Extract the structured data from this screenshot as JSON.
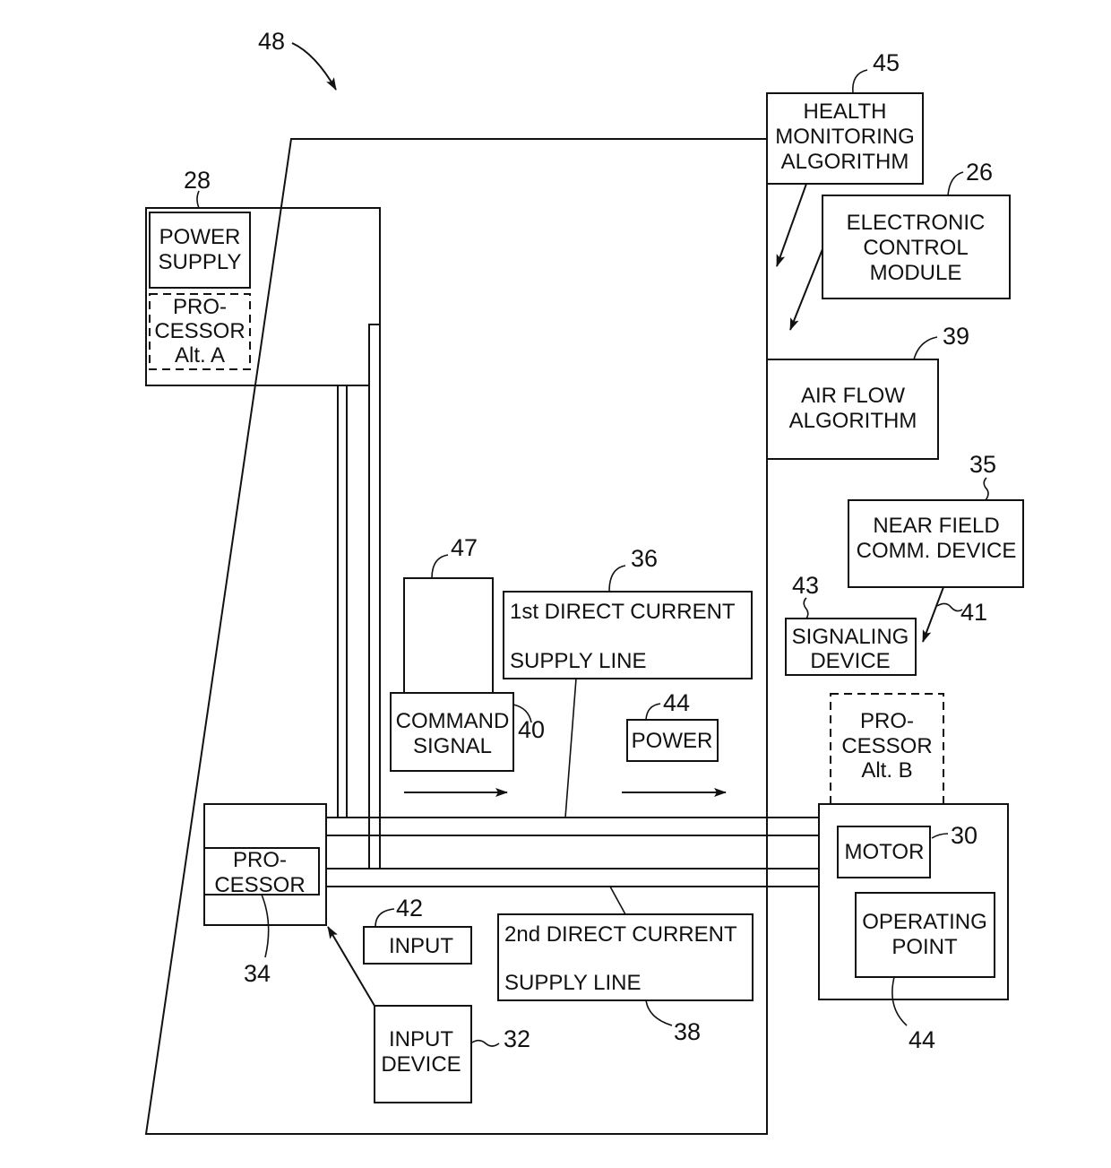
{
  "figure": {
    "assembly_ref": "48",
    "blocks": {
      "power_supply_housing": {
        "ref": "28"
      },
      "power_supply": {
        "lines": [
          "POWER",
          "SUPPLY"
        ]
      },
      "processor_alt_a": {
        "lines": [
          "PRO-",
          "CESSOR",
          "Alt. A"
        ]
      },
      "health_monitoring": {
        "ref": "45",
        "lines": [
          "HEALTH",
          "MONITORING",
          "ALGORITHM"
        ]
      },
      "electronic_control_module": {
        "ref": "26",
        "lines": [
          "ELECTRONIC",
          "CONTROL",
          "MODULE"
        ]
      },
      "air_flow_algorithm": {
        "ref": "39",
        "lines": [
          "AIR FLOW",
          "ALGORITHM"
        ]
      },
      "near_field_comm": {
        "ref": "35",
        "lines": [
          "NEAR FIELD",
          "COMM. DEVICE"
        ]
      },
      "signaling_device": {
        "ref": "43",
        "lines": [
          "SIGNALING",
          "DEVICE"
        ]
      },
      "nfc_link": {
        "ref": "41"
      },
      "block_47": {
        "ref": "47"
      },
      "command_signal": {
        "ref": "40",
        "lines": [
          "COMMAND",
          "SIGNAL"
        ]
      },
      "first_dc_line": {
        "ref": "36",
        "lines": [
          "1st DIRECT CURRENT",
          "SUPPLY LINE"
        ]
      },
      "power": {
        "ref": "44",
        "lines": [
          "POWER"
        ]
      },
      "processor_alt_b": {
        "lines": [
          "PRO-",
          "CESSOR",
          "Alt. B"
        ]
      },
      "motor": {
        "ref": "30",
        "lines": [
          "MOTOR"
        ]
      },
      "operating_point": {
        "ref": "44",
        "lines": [
          "OPERATING",
          "POINT"
        ]
      },
      "processor": {
        "ref": "34",
        "lines": [
          "PRO-",
          "CESSOR"
        ]
      },
      "input": {
        "ref": "42",
        "lines": [
          "INPUT"
        ]
      },
      "second_dc_line": {
        "ref": "38",
        "lines": [
          "2nd DIRECT CURRENT",
          "SUPPLY LINE"
        ]
      },
      "input_device": {
        "ref": "32",
        "lines": [
          "INPUT",
          "DEVICE"
        ]
      }
    }
  }
}
